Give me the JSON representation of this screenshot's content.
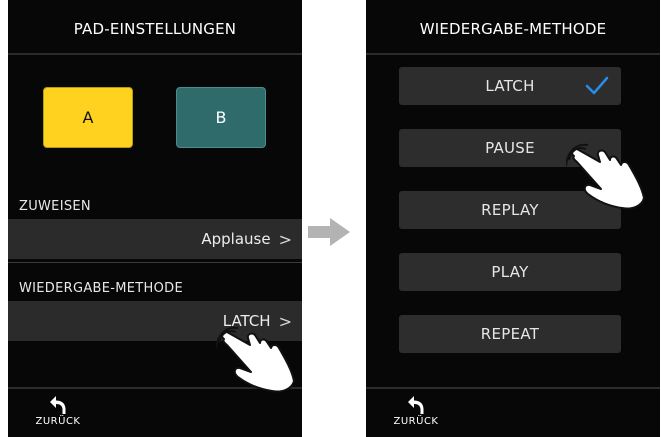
{
  "left_screen": {
    "title": "PAD-EINSTELLUNGEN",
    "pads": [
      {
        "label": "A",
        "color": "#ffd21f"
      },
      {
        "label": "B",
        "color": "#2f6b6a"
      }
    ],
    "assign": {
      "label": "ZUWEISEN",
      "value": "Applause"
    },
    "playback_method": {
      "label": "WIEDERGABE-METHODE",
      "value": "LATCH"
    },
    "chevron": ">",
    "back_label": "ZURÜCK"
  },
  "right_screen": {
    "title": "WIEDERGABE-METHODE",
    "options": [
      {
        "label": "LATCH",
        "selected": true
      },
      {
        "label": "PAUSE",
        "selected": false
      },
      {
        "label": "REPLAY",
        "selected": false
      },
      {
        "label": "PLAY",
        "selected": false
      },
      {
        "label": "REPEAT",
        "selected": false
      }
    ],
    "check_color": "#2b8be8",
    "back_label": "ZURÜCK"
  },
  "icons": [
    "back-arrow-icon",
    "checkmark-icon",
    "chevron-right-icon",
    "arrow-right-icon",
    "tap-hand-icon"
  ],
  "colors": {
    "screen_bg": "#070707",
    "row_bg": "#2b2b2b",
    "arrow": "#b3b3b3"
  }
}
